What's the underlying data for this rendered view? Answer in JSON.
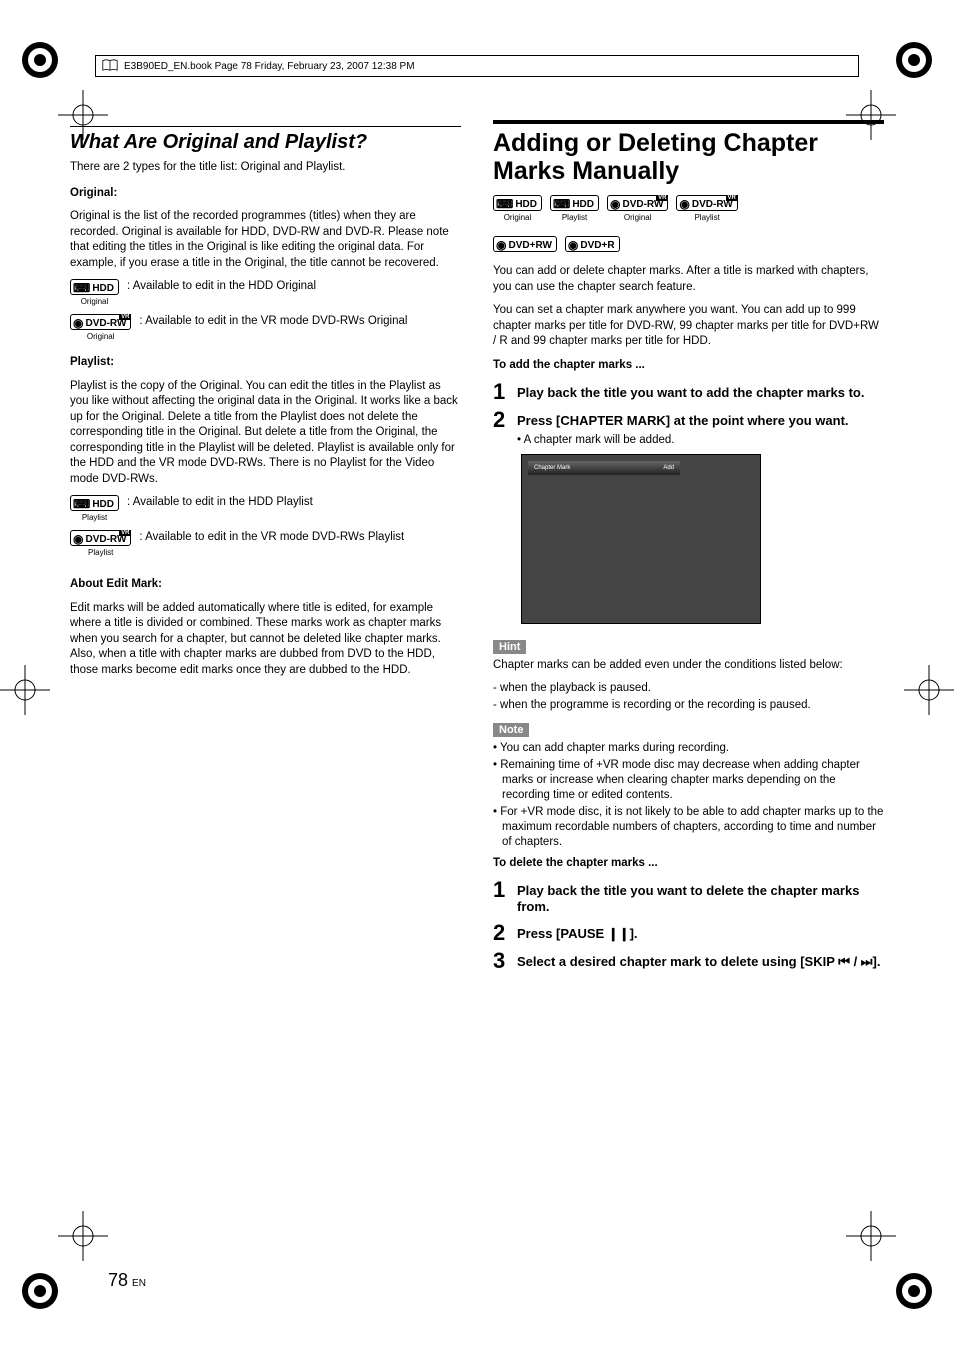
{
  "header": {
    "text": "E3B90ED_EN.book  Page 78  Friday, February 23, 2007  12:38 PM"
  },
  "page_number": "78",
  "page_lang": "EN",
  "left": {
    "title": "What Are Original and Playlist?",
    "intro": "There are 2 types for the title list: Original and Playlist.",
    "original_heading": "Original:",
    "original_body": "Original is the list of the recorded programmes (titles) when they are recorded. Original is available for HDD, DVD-RW and DVD-R. Please note that editing the titles in the Original is like editing the original data. For example, if you erase a title in the Original, the title cannot be recovered.",
    "icons_original": [
      {
        "label": "HDD",
        "sub": "Original",
        "vr": false,
        "desc": ": Available to edit in the HDD Original"
      },
      {
        "label": "DVD-RW",
        "sub": "Original",
        "vr": true,
        "desc": ": Available to edit in the VR mode DVD-RWs Original"
      }
    ],
    "playlist_heading": "Playlist:",
    "playlist_body": "Playlist is the copy of the Original. You can edit the titles in the Playlist as you like without affecting the original data in the Original. It works like a back up for the Original. Delete a title from the Playlist does not delete the corresponding title in the Original. But delete a title from the Original, the corresponding title in the Playlist will be deleted. Playlist is available only for the HDD and the VR mode DVD-RWs. There is no Playlist for the Video mode DVD-RWs.",
    "icons_playlist": [
      {
        "label": "HDD",
        "sub": "Playlist",
        "vr": false,
        "desc": ": Available to edit in the HDD Playlist"
      },
      {
        "label": "DVD-RW",
        "sub": "Playlist",
        "vr": true,
        "desc": ": Available to edit in the VR mode DVD-RWs Playlist"
      }
    ],
    "edit_heading": "About Edit Mark:",
    "edit_body": "Edit marks will be added automatically where title is edited, for example where a title is divided or combined. These marks work as chapter marks when you search for a chapter, but cannot be deleted like chapter marks. Also, when a title with chapter marks are dubbed from DVD to the HDD, those marks become edit marks once they are dubbed to the HDD."
  },
  "right": {
    "title": "Adding or Deleting Chapter Marks Manually",
    "disc_icons": [
      {
        "label": "HDD",
        "sub": "Original",
        "vr": false
      },
      {
        "label": "HDD",
        "sub": "Playlist",
        "vr": false
      },
      {
        "label": "DVD-RW",
        "sub": "Original",
        "vr": true
      },
      {
        "label": "DVD-RW",
        "sub": "Playlist",
        "vr": true
      },
      {
        "label": "DVD+RW",
        "sub": "",
        "vr": false
      },
      {
        "label": "DVD+R",
        "sub": "",
        "vr": false
      }
    ],
    "intro1": "You can add or delete chapter marks. After a title is marked with chapters, you can use the chapter search feature.",
    "intro2": "You can set a chapter mark anywhere you want. You can add up to 999 chapter marks per title for DVD-RW, 99 chapter marks per title for DVD+RW / R and 99 chapter marks per title for HDD.",
    "add_heading": "To add the chapter marks ...",
    "add_steps": [
      {
        "n": "1",
        "text": "Play back the title you want to add the chapter marks to."
      },
      {
        "n": "2",
        "text": "Press [CHAPTER MARK] at the point where you want.",
        "sub": "• A chapter mark will be added."
      }
    ],
    "screenshot": {
      "left_label": "Chapter Mark",
      "right_label": "Add"
    },
    "hint_label": "Hint",
    "hint_intro": "Chapter marks can be added even under the conditions listed below:",
    "hint_items": [
      "when the playback is paused.",
      "when the programme is recording or the recording is paused."
    ],
    "note_label": "Note",
    "note_items": [
      "You can add chapter marks during recording.",
      "Remaining time of +VR mode disc may decrease when adding chapter marks or increase when clearing chapter marks depending on the recording time or edited contents.",
      "For +VR mode disc, it is not likely to be able to add chapter marks up to the maximum recordable numbers of chapters, according to time and number of chapters."
    ],
    "del_heading": "To delete the chapter marks ...",
    "del_steps": [
      {
        "n": "1",
        "text": "Play back the title you want to delete the chapter marks from."
      },
      {
        "n": "2",
        "text": "Press [PAUSE ❙❙]."
      },
      {
        "n": "3",
        "text": "Select a desired chapter mark to delete using [SKIP ⏮ / ⏭]."
      }
    ]
  }
}
